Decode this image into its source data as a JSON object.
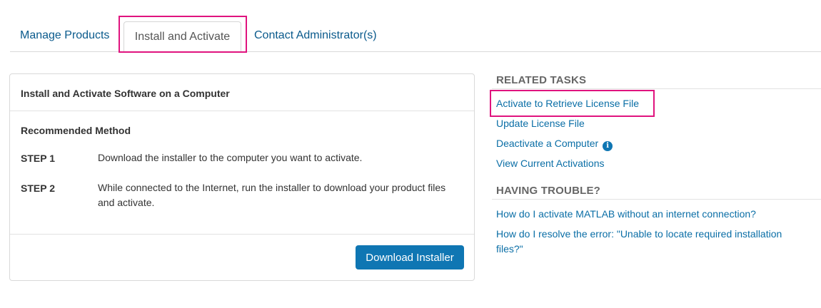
{
  "tabs": {
    "manage_products": "Manage Products",
    "install_activate": "Install and Activate",
    "contact_admin": "Contact Administrator(s)"
  },
  "panel": {
    "title": "Install and Activate Software on a Computer",
    "method_title": "Recommended Method",
    "steps": [
      {
        "label": "STEP 1",
        "text": "Download the installer to the computer you want to activate."
      },
      {
        "label": "STEP 2",
        "text": "While connected to the Internet, run the installer to download your product files and activate."
      }
    ],
    "download_button": "Download Installer"
  },
  "related": {
    "heading": "RELATED TASKS",
    "links": [
      "Activate to Retrieve License File",
      "Update License File",
      "Deactivate a Computer",
      "View Current Activations"
    ]
  },
  "trouble": {
    "heading": "HAVING TROUBLE?",
    "links": [
      "How do I activate MATLAB without an internet connection?",
      "How do I resolve the error: \"Unable to locate required installation files?\""
    ]
  },
  "icons": {
    "info": "info-icon"
  },
  "colors": {
    "link": "#0a6ea6",
    "button": "#0f76b3",
    "highlight": "#e0137e"
  }
}
